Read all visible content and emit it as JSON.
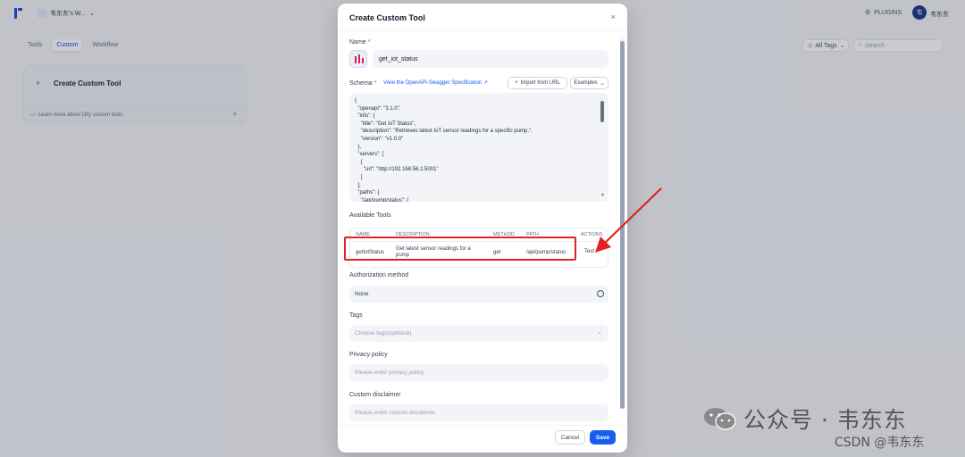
{
  "app": {
    "workspace_name": "韦东东's W...",
    "plugins_label": "PLUGINS",
    "user_initial": "韦",
    "user_name": "韦东东",
    "tabs": [
      {
        "label": "Tools"
      },
      {
        "label": "Custom",
        "active": true
      },
      {
        "label": "Workflow"
      }
    ],
    "all_tags_label": "All Tags",
    "search_placeholder": "Search",
    "create_card_title": "Create Custom Tool",
    "learn_more": "Learn more about Dify custom tools"
  },
  "modal": {
    "title": "Create Custom Tool",
    "name_label": "Name",
    "required_mark": "*",
    "name_value": "get_iot_status",
    "schema_label": "Schema",
    "spec_link": "View the OpenAPI-Swagger Specification",
    "import_button": "Import from URL",
    "examples_button": "Examples",
    "schema_text": "{\n  \"openapi\": \"3.1.0\",\n  \"info\": {\n    \"title\": \"Get IoT Status\",\n    \"description\": \"Retrieves latest IoT sensor readings for a specific pump.\",\n    \"version\": \"v1.0.0\"\n  },\n  \"servers\": [\n    {\n      \"url\": \"http://192.168.56.1:5001\"\n    }\n  ],\n  \"paths\": {\n    \"/api/pump/status\": {",
    "available_tools_label": "Available Tools",
    "table": {
      "headers": [
        "NAME",
        "DESCRIPTION",
        "METHOD",
        "PATH",
        "ACTIONS"
      ],
      "rows": [
        {
          "name": "getIotStatus",
          "description": "Get latest sensor readings for a pump",
          "method": "get",
          "path": "/api/pump/status",
          "action": "Test"
        }
      ]
    },
    "auth_label": "Authorization method",
    "auth_value": "None",
    "tags_label": "Tags",
    "tags_placeholder": "Choose tags(optional)",
    "privacy_label": "Privacy policy",
    "privacy_placeholder": "Please enter privacy policy",
    "disclaimer_label": "Custom disclaimer",
    "disclaimer_placeholder": "Please enter custom disclaimer",
    "cancel_button": "Cancel",
    "save_button": "Save"
  },
  "watermarks": {
    "wechat": "公众号 · 韦东东",
    "csdn": "CSDN @韦东东"
  },
  "colors": {
    "primary": "#155eef",
    "annotation_red": "#e02424",
    "required": "#f04438"
  },
  "icons": {
    "close": "close-icon",
    "plus": "plus-icon",
    "gear": "gear-icon",
    "tag": "tag-icon",
    "search": "search-icon",
    "external_link": "external-link-icon",
    "chevron_down": "chevron-down-icon"
  }
}
